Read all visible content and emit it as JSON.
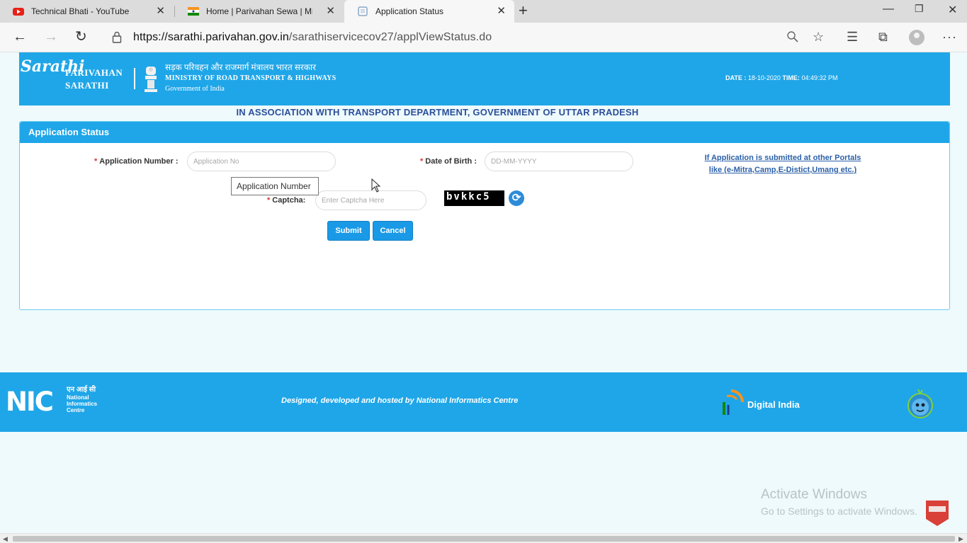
{
  "browser": {
    "tabs": [
      {
        "title": "Technical Bhati - YouTube",
        "icon": "youtube-icon",
        "active": false
      },
      {
        "title": "Home | Parivahan Sewa | Ministr",
        "icon": "india-flag-icon",
        "active": false
      },
      {
        "title": "Application Status",
        "icon": "page-icon",
        "active": true
      }
    ],
    "url_domain": "https://sarathi.parivahan.gov.in",
    "url_path": "/sarathiservicecov27/applViewStatus.do"
  },
  "header": {
    "logo_script": "Sarathi",
    "logo_line1": "PARIVAHAN",
    "logo_line2": "SARATHI",
    "ministry_hindi": "सड़क परिवहन और राजमार्ग मंत्रालय भारत सरकार",
    "ministry_en": "MINISTRY OF ROAD TRANSPORT & HIGHWAYS",
    "govt": "Government of India",
    "date_label": "DATE :",
    "date_value": "18-10-2020",
    "time_label": "TIME:",
    "time_value": "04:49:32 PM"
  },
  "association_text": "IN ASSOCIATION WITH TRANSPORT DEPARTMENT, GOVERNMENT OF UTTAR PRADESH",
  "form": {
    "panel_title": "Application Status",
    "app_number_label": "Application Number :",
    "app_number_placeholder": "Application No",
    "dob_label": "Date of Birth :",
    "dob_placeholder": "DD-MM-YYYY",
    "captcha_label": "Captcha:",
    "captcha_placeholder": "Enter Captcha Here",
    "captcha_text": "bvkkc5",
    "required_mark": "*",
    "tooltip": "Application Number",
    "submit_label": "Submit",
    "cancel_label": "Cancel",
    "portal_link_line1": "If Application is submitted at other Portals",
    "portal_link_line2": "like (e-Mitra,Camp,E-Distict,Umang etc.)"
  },
  "footer": {
    "nic_logo": "NIC",
    "nic_hindi": "एन आई सी",
    "nic_line1": "National",
    "nic_line2": "Informatics",
    "nic_line3": "Centre",
    "credit": "Designed, developed and hosted by National Informatics Centre",
    "digital_india": "Digital India"
  },
  "watermark": {
    "line1": "Activate Windows",
    "line2": "Go to Settings to activate Windows."
  },
  "colors": {
    "brand_blue": "#1fa6e8",
    "association_text": "#2b4f9a",
    "link": "#2a5fa8"
  }
}
